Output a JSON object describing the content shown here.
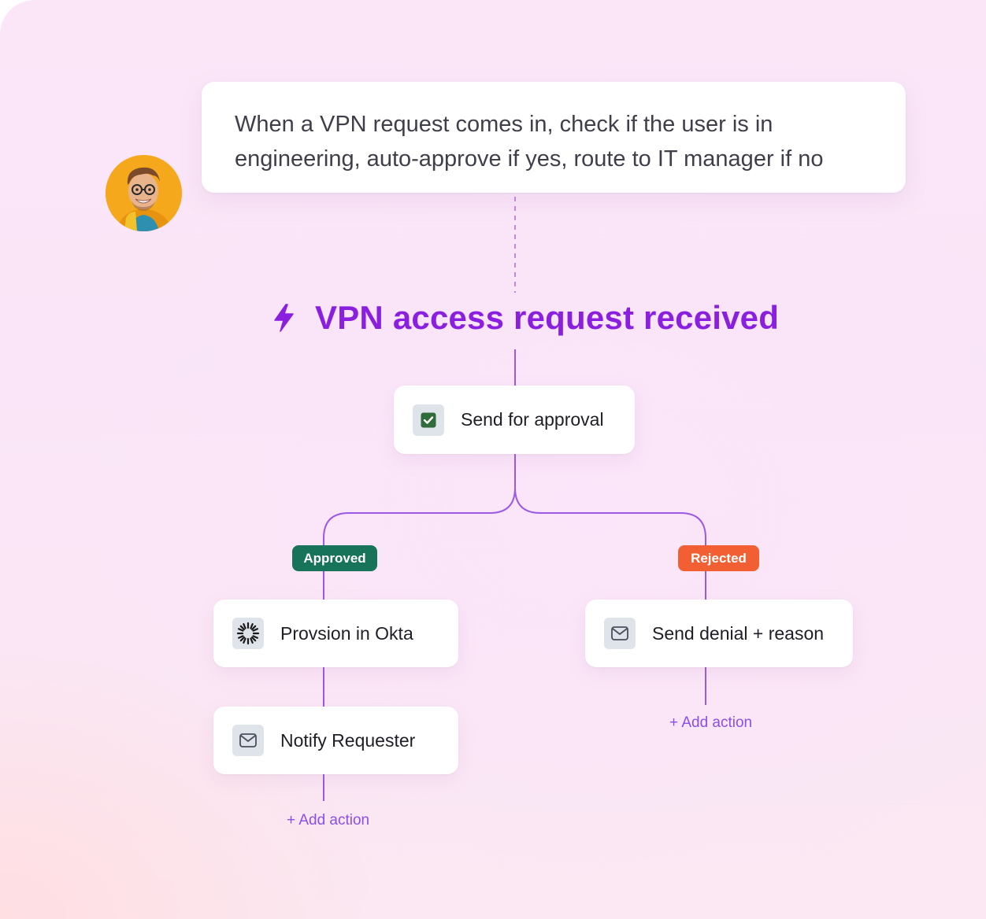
{
  "prompt": {
    "line1": "When a VPN request comes in, check if the user is in",
    "line2": "engineering, auto-approve if yes, route to IT manager if no"
  },
  "trigger": {
    "icon": "lightning-bolt-icon",
    "title": "VPN access request received"
  },
  "approval_step": {
    "icon": "checkbox-checked-icon",
    "label": "Send for approval"
  },
  "branches": {
    "approved": {
      "badge": "Approved",
      "steps": [
        {
          "icon": "okta-logo-icon",
          "label": "Provsion in Okta"
        },
        {
          "icon": "mail-icon",
          "label": "Notify Requester"
        }
      ],
      "add_action": "+ Add action"
    },
    "rejected": {
      "badge": "Rejected",
      "steps": [
        {
          "icon": "mail-icon",
          "label": "Send denial + reason"
        }
      ],
      "add_action": "+ Add action"
    }
  },
  "colors": {
    "trigger_purple": "#8a1fe0",
    "connector": "#9b59e6",
    "approved_badge": "#17735a",
    "rejected_badge": "#f25f33",
    "add_action": "#8a4fe8",
    "check_green": "#2f6b3b"
  }
}
